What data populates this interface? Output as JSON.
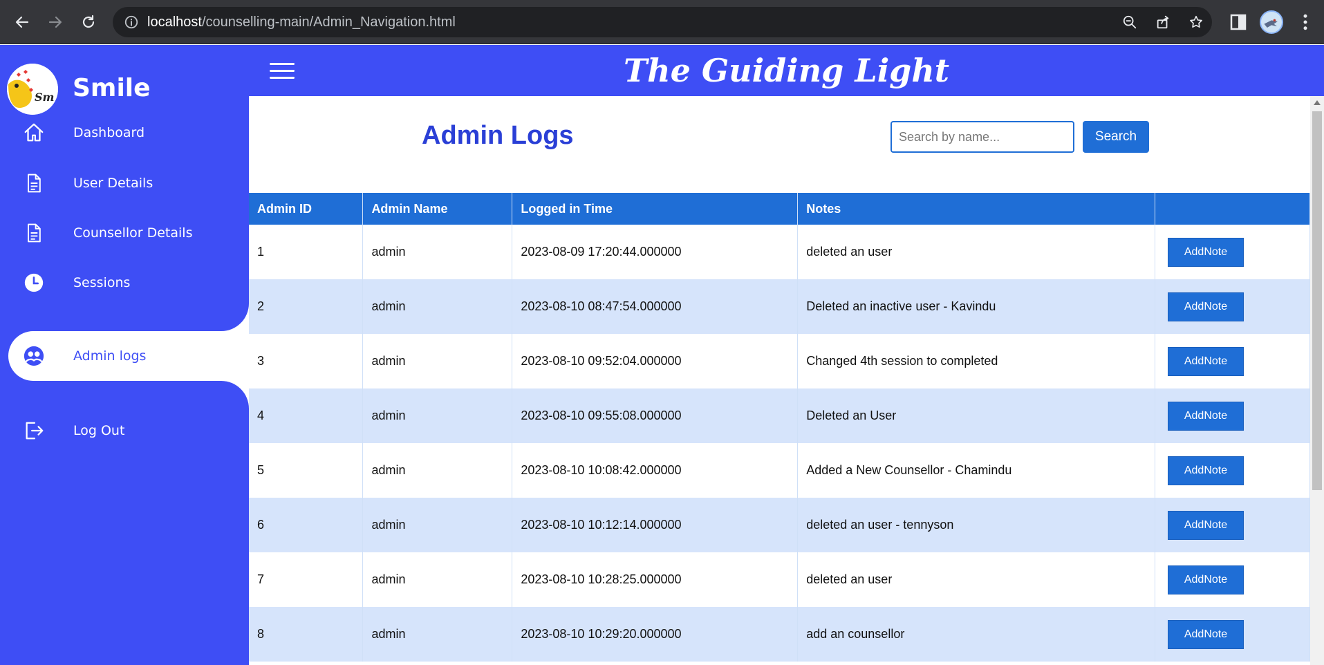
{
  "browser": {
    "url_host": "localhost",
    "url_path": "/counselling-main/Admin_Navigation.html",
    "icons": [
      "back-arrow-icon",
      "forward-arrow-icon",
      "reload-icon",
      "info-icon",
      "zoom-out-icon",
      "share-icon",
      "bookmark-star-icon",
      "side-panel-icon",
      "profile-avatar"
    ]
  },
  "sidebar": {
    "brand": "Smile",
    "items": [
      {
        "label": "Dashboard",
        "icon": "home-icon"
      },
      {
        "label": "User Details",
        "icon": "document-icon"
      },
      {
        "label": "Counsellor Details",
        "icon": "document-icon"
      },
      {
        "label": "Sessions",
        "icon": "clock-icon"
      },
      {
        "label": "Admin logs",
        "icon": "users-icon",
        "active": true
      },
      {
        "label": "Log Out",
        "icon": "logout-icon"
      }
    ]
  },
  "header": {
    "title": "The Guiding Light"
  },
  "main": {
    "title": "Admin Logs",
    "search_placeholder": "Search by name...",
    "search_button": "Search",
    "table": {
      "headers": [
        "Admin ID",
        "Admin Name",
        "Logged in Time",
        "Notes",
        ""
      ],
      "action_label": "AddNote",
      "rows": [
        {
          "id": "1",
          "name": "admin",
          "time": "2023-08-09 17:20:44.000000",
          "note": "deleted an user"
        },
        {
          "id": "2",
          "name": "admin",
          "time": "2023-08-10 08:47:54.000000",
          "note": "Deleted an inactive user - Kavindu"
        },
        {
          "id": "3",
          "name": "admin",
          "time": "2023-08-10 09:52:04.000000",
          "note": "Changed 4th session to completed"
        },
        {
          "id": "4",
          "name": "admin",
          "time": "2023-08-10 09:55:08.000000",
          "note": "Deleted an User"
        },
        {
          "id": "5",
          "name": "admin",
          "time": "2023-08-10 10:08:42.000000",
          "note": "Added a New Counsellor - Chamindu"
        },
        {
          "id": "6",
          "name": "admin",
          "time": "2023-08-10 10:12:14.000000",
          "note": "deleted an user - tennyson"
        },
        {
          "id": "7",
          "name": "admin",
          "time": "2023-08-10 10:28:25.000000",
          "note": "deleted an user"
        },
        {
          "id": "8",
          "name": "admin",
          "time": "2023-08-10 10:29:20.000000",
          "note": "add an counsellor"
        }
      ]
    }
  },
  "colors": {
    "sidebar": "#3e4ef5",
    "table_header": "#1f6ed6",
    "row_alt": "#d6e4fb",
    "title": "#2a3fd6"
  }
}
